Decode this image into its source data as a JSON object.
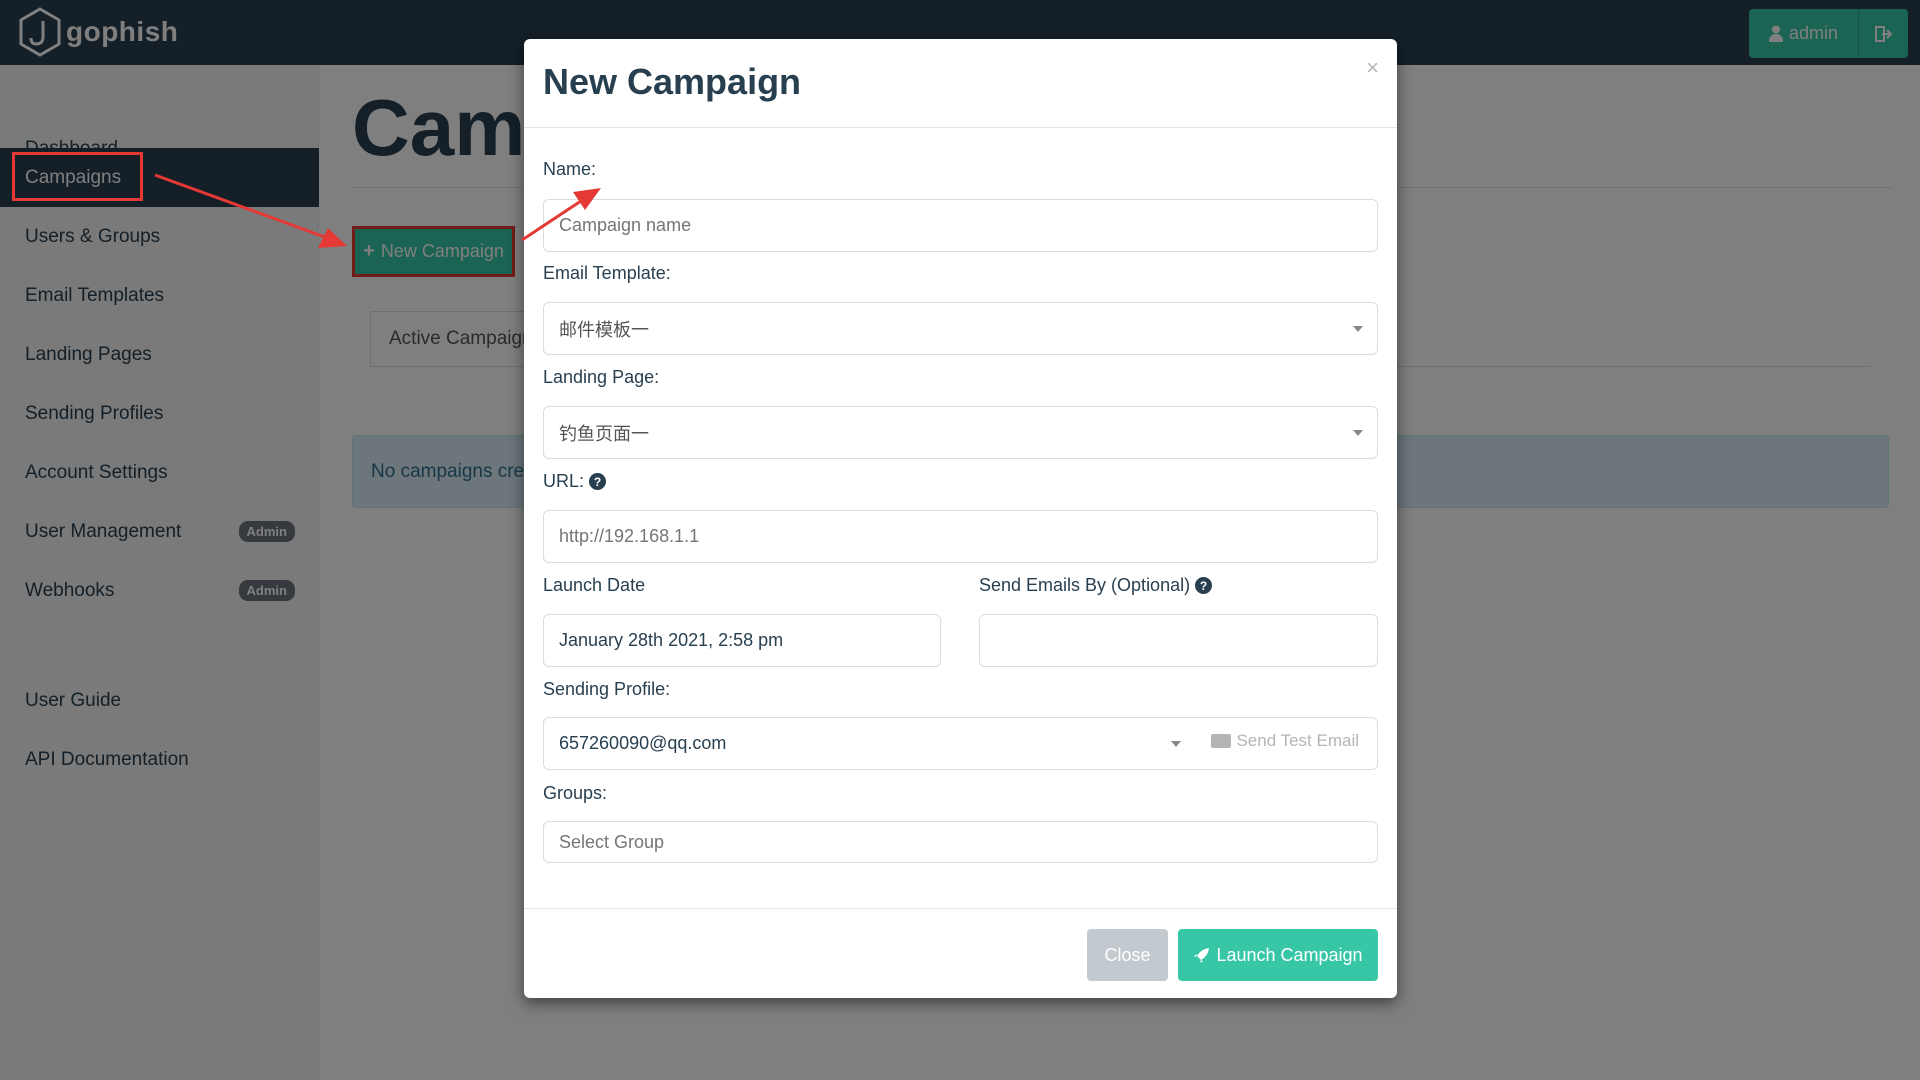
{
  "app": {
    "logo_text": "gophish"
  },
  "navbar": {
    "user_label": "admin"
  },
  "sidebar": {
    "items": [
      {
        "label": "Dashboard"
      },
      {
        "label": "Campaigns"
      },
      {
        "label": "Users & Groups"
      },
      {
        "label": "Email Templates"
      },
      {
        "label": "Landing Pages"
      },
      {
        "label": "Sending Profiles"
      },
      {
        "label": "Account Settings"
      },
      {
        "label": "User Management",
        "badge": "Admin"
      },
      {
        "label": "Webhooks",
        "badge": "Admin"
      },
      {
        "label": "User Guide"
      },
      {
        "label": "API Documentation"
      }
    ],
    "active": "Campaigns"
  },
  "main": {
    "title": "Camp",
    "new_campaign_label": "New Campaign",
    "tab_label": "Active Campaign",
    "alert_text": "No campaigns crea"
  },
  "modal": {
    "title": "New Campaign",
    "close_symbol": "×",
    "name": {
      "label": "Name:",
      "placeholder": "Campaign name",
      "value": ""
    },
    "email_template": {
      "label": "Email Template:",
      "value": "邮件模板一"
    },
    "landing_page": {
      "label": "Landing Page:",
      "value": "钓鱼页面一"
    },
    "url": {
      "label": "URL:",
      "placeholder": "http://192.168.1.1"
    },
    "launch_date": {
      "label": "Launch Date",
      "value": "January 28th 2021, 2:58 pm"
    },
    "send_by": {
      "label": "Send Emails By (Optional)",
      "value": ""
    },
    "sending_profile": {
      "label": "Sending Profile:",
      "value": "657260090@qq.com",
      "test_email_label": "Send Test Email"
    },
    "groups": {
      "label": "Groups:",
      "placeholder": "Select Group"
    },
    "footer": {
      "close_label": "Close",
      "launch_label": "Launch Campaign"
    }
  },
  "colors": {
    "navbar": "#283f50",
    "accent": "#37c6a6",
    "annotation": "#e53935"
  }
}
